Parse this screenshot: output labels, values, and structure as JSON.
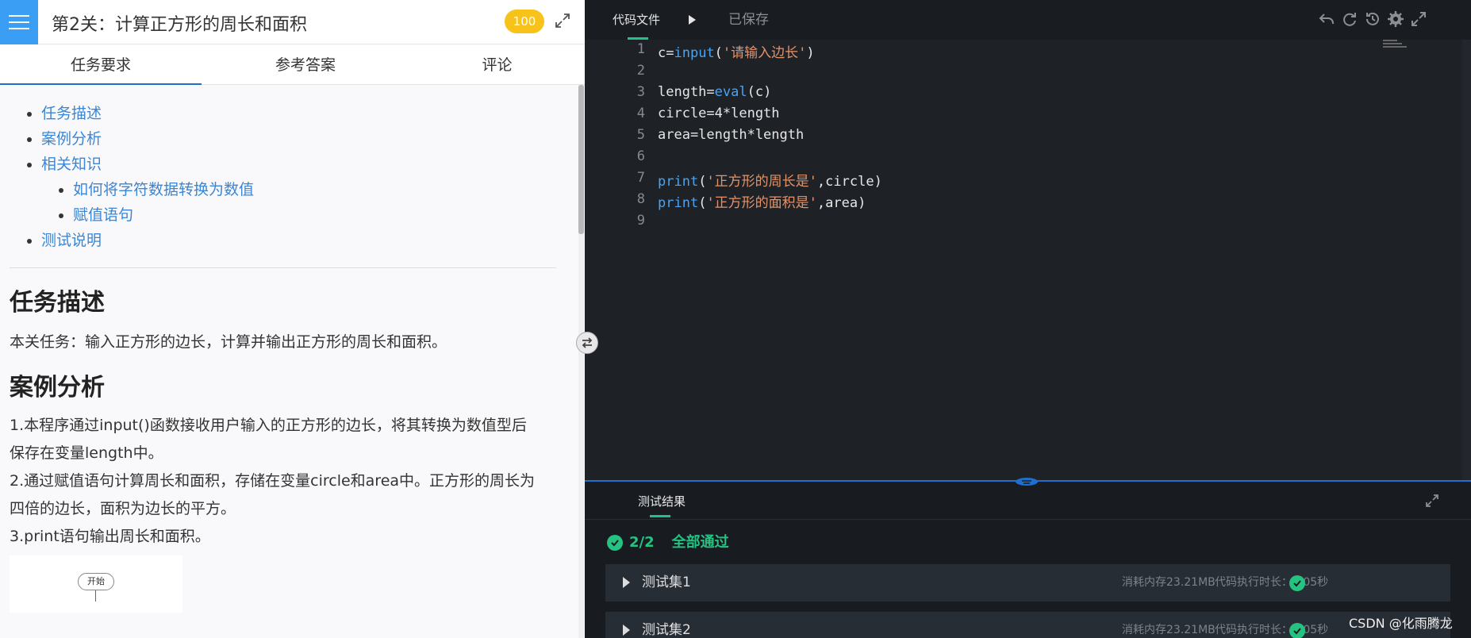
{
  "header": {
    "title": "第2关：计算正方形的周长和面积",
    "score": "100"
  },
  "tabs": [
    "任务要求",
    "参考答案",
    "评论"
  ],
  "toc": {
    "items": [
      "任务描述",
      "案例分析",
      "相关知识",
      "测试说明"
    ],
    "sub_items": [
      "如何将字符数据转换为数值",
      "赋值语句"
    ]
  },
  "content": {
    "h_task": "任务描述",
    "task_text": "本关任务：输入正方形的边长，计算并输出正方形的周长和面积。",
    "h_case": "案例分析",
    "case_p1a": "1.本程序通过input()函数接收用户输入的正方形的边长，将其转换为数值型后",
    "case_p1b": "保存在变量length中。",
    "case_p2a": "2.通过赋值语句计算周长和面积，存储在变量circle和area中。正方形的周长为",
    "case_p2b": "四倍的边长，面积为边长的平方。",
    "case_p3": "3.print语句输出周长和面积。",
    "flow_start": "开始"
  },
  "editor": {
    "file_tab": "代码文件",
    "save_status": "已保存",
    "line_numbers": [
      "1",
      "2",
      "3",
      "4",
      "5",
      "6",
      "7",
      "8",
      "9"
    ],
    "code": {
      "l1_a": "c=",
      "l1_fn": "input",
      "l1_b": "(",
      "l1_str": "'请输入边长'",
      "l1_c": ")",
      "l3_a": "length=",
      "l3_fn": "eval",
      "l3_b": "(c)",
      "l4": "circle=4*length",
      "l5": "area=length*length",
      "l7_fn": "print",
      "l7_a": "(",
      "l7_str": "'正方形的周长是'",
      "l7_b": ",circle)",
      "l8_fn": "print",
      "l8_a": "(",
      "l8_str": "'正方形的面积是'",
      "l8_b": ",area)"
    }
  },
  "results": {
    "tab": "测试结果",
    "count": "2/2",
    "status": "全部通过",
    "sets": [
      {
        "name": "测试集1",
        "memory": "消耗内存23.21MB",
        "time": "代码执行时长：0.05秒"
      },
      {
        "name": "测试集2",
        "memory": "消耗内存23.21MB",
        "time": "代码执行时长：0.05秒"
      }
    ]
  },
  "watermark": "CSDN @化雨腾龙",
  "icons": [
    "menu-icon",
    "expand-icon",
    "play-icon",
    "undo-icon",
    "refresh-icon",
    "history-icon",
    "gear-icon",
    "fullscreen-icon",
    "check-icon",
    "swap-icon"
  ],
  "colors": {
    "accent": "#3a9ef5",
    "pass": "#26c281",
    "badge": "#f7c21a",
    "editor_bg": "#1e2227"
  }
}
